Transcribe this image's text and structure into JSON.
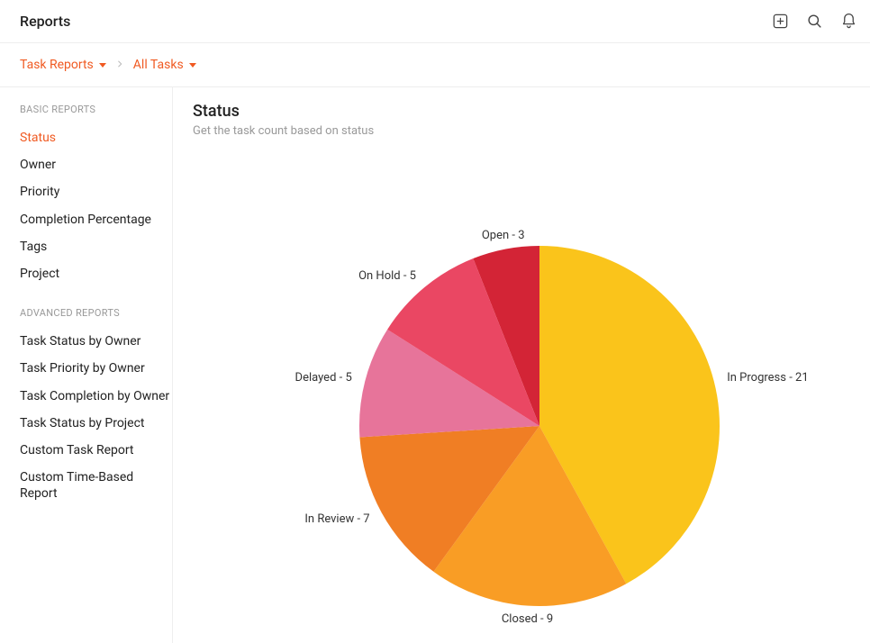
{
  "header": {
    "title": "Reports"
  },
  "breadcrumbs": {
    "crumb1": "Task Reports",
    "crumb2": "All Tasks"
  },
  "sidebar": {
    "basic_header": "BASIC REPORTS",
    "basic_items": [
      "Status",
      "Owner",
      "Priority",
      "Completion Percentage",
      "Tags",
      "Project"
    ],
    "advanced_header": "ADVANCED REPORTS",
    "advanced_items": [
      "Task Status by Owner",
      "Task Priority by Owner",
      "Task Completion by Owner",
      "Task Status by Project",
      "Custom Task Report",
      "Custom Time-Based Report"
    ]
  },
  "content": {
    "title": "Status",
    "subtitle": "Get the task count based on status"
  },
  "chart_data": {
    "type": "pie",
    "title": "Status",
    "categories": [
      "Open",
      "In Progress",
      "Closed",
      "In Review",
      "Delayed",
      "On Hold"
    ],
    "values": [
      3,
      21,
      9,
      7,
      5,
      5
    ],
    "colors": [
      "#d32436",
      "#fac41b",
      "#f99d25",
      "#f07e24",
      "#e7749a",
      "#ea4763"
    ],
    "label_sep": " - "
  }
}
